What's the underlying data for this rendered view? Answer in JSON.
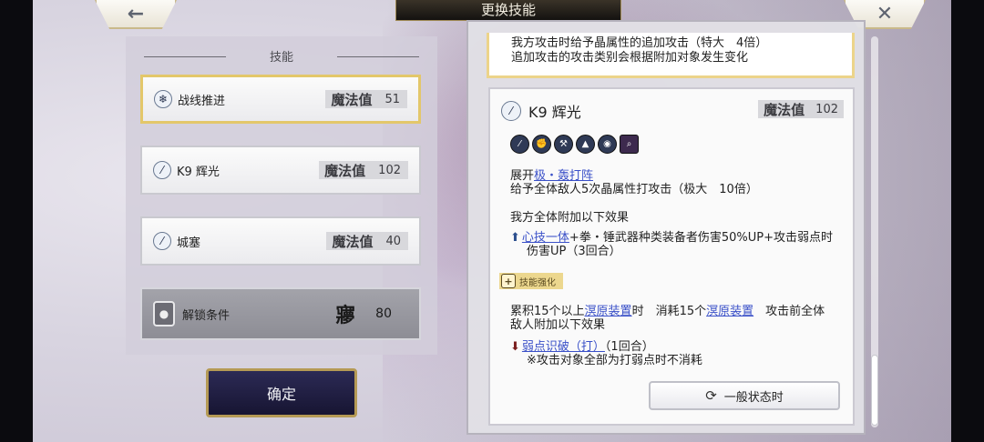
{
  "header": {
    "title": "更换技能",
    "back_icon": "←",
    "close_icon": "✕"
  },
  "skill_list": {
    "heading": "技能",
    "items": [
      {
        "icon": "snowflake",
        "name": "战线推进",
        "mp_label": "魔法值",
        "mp": "51",
        "selected": true
      },
      {
        "icon": "slash",
        "name": "K9 辉光",
        "mp_label": "魔法值",
        "mp": "102",
        "selected": false
      },
      {
        "icon": "slash",
        "name": "城塞",
        "mp_label": "魔法值",
        "mp": "40",
        "selected": false
      }
    ],
    "locked": {
      "label": "解锁条件",
      "glyph": "㝱",
      "value": "80"
    }
  },
  "confirm_label": "确定",
  "detail": {
    "prev_lines": [
      "我方攻击时给予晶属性的追加攻击（特大　4倍）",
      "追加攻击的攻击类别会根据附加对象发生变化"
    ],
    "name": "K9 辉光",
    "mp_label": "魔法值",
    "mp": "102",
    "type_icons": [
      "slash-icon",
      "fist-icon",
      "hammer-icon",
      "hammer-up-icon",
      "eye-icon",
      "search-icon"
    ],
    "deploy_prefix": "展开",
    "deploy_link": "极・轰打阵",
    "line_damage": "给予全体敌人5次晶属性打攻击（极大　10倍）",
    "line_effect_head": "我方全体附加以下效果",
    "buff_link": "心技一体",
    "buff_text_1": "+拳・锤武器种类装备者伤害50%UP+攻击弱点时",
    "buff_text_2": "伤害UP（3回合）",
    "enhance_label": "技能强化",
    "cond_prefix": "累积15个以上",
    "cond_link_1": "溟原装置",
    "cond_mid": "时　消耗15个",
    "cond_link_2": "溟原装置",
    "cond_suffix": "　攻击前全体",
    "cond_line_2": "敌人附加以下效果",
    "debuff_link": "弱点识破（打）",
    "debuff_turns": "（1回合）",
    "note": "※攻击对象全部为打弱点时不消耗",
    "state_button": "一般状态时"
  }
}
